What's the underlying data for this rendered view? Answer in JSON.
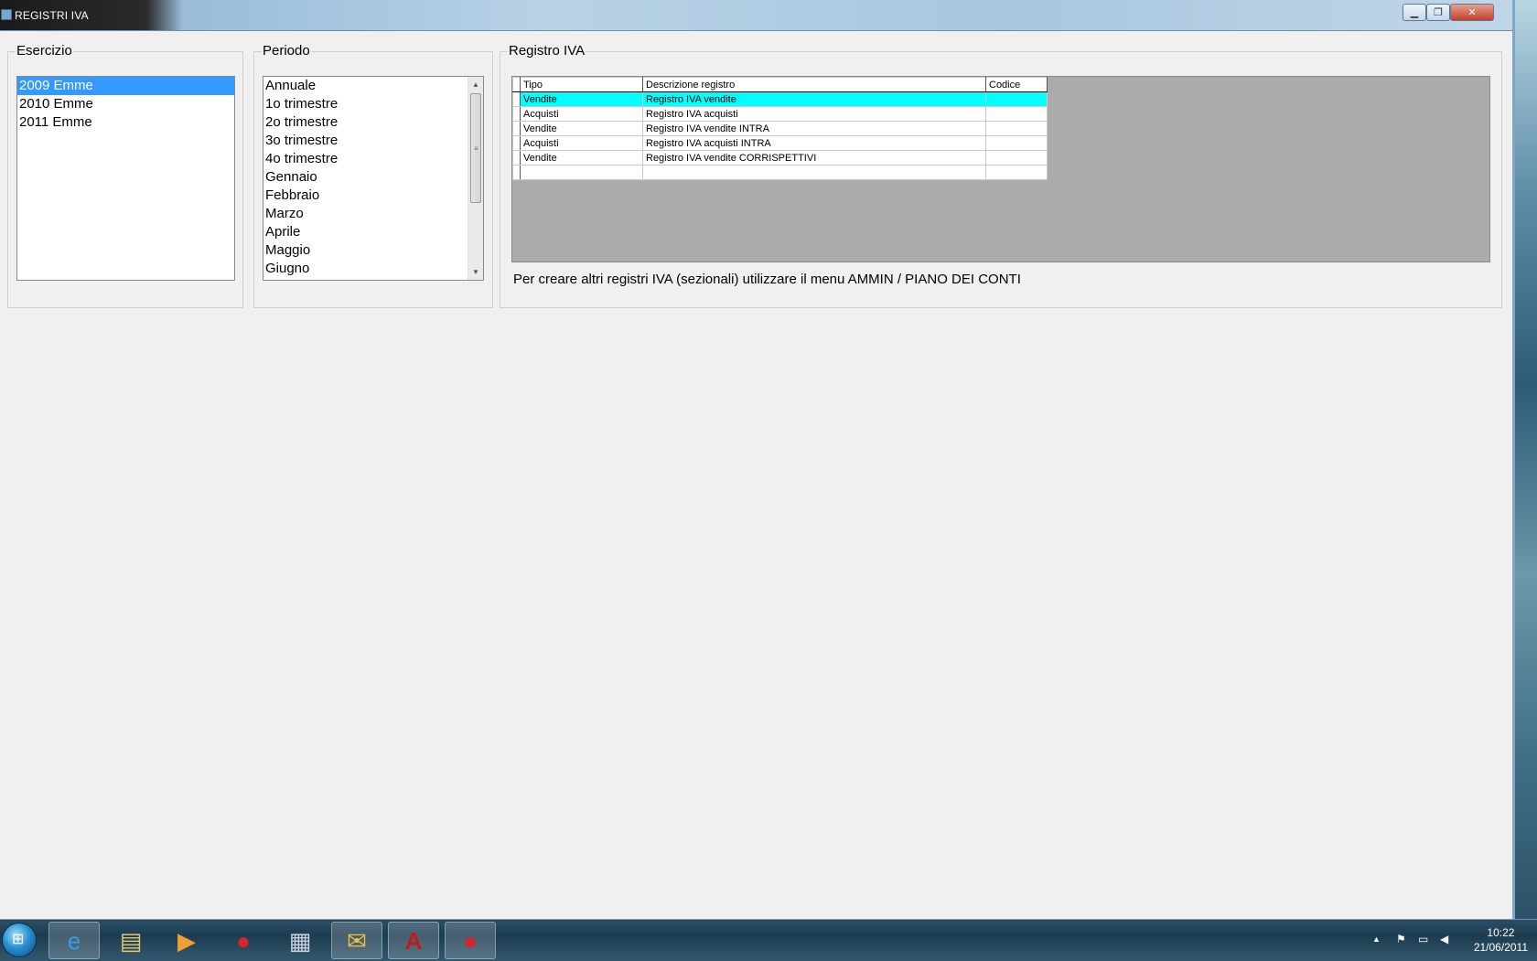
{
  "window": {
    "title": "REGISTRI IVA",
    "controls": {
      "minimize": "▁",
      "maximize": "❐",
      "close": "✕"
    }
  },
  "esercizio": {
    "label": "Esercizio",
    "items": [
      "2009 Emme",
      "2010 Emme",
      "2011 Emme"
    ],
    "selected_index": 0
  },
  "periodo": {
    "label": "Periodo",
    "items": [
      "Annuale",
      "1o trimestre",
      "2o trimestre",
      "3o trimestre",
      "4o trimestre",
      "Gennaio",
      "Febbraio",
      "Marzo",
      "Aprile",
      "Maggio",
      "Giugno"
    ],
    "scroll_up": "▲",
    "scroll_down": "▼",
    "scroll_grip": "≡"
  },
  "registro": {
    "label": "Registro IVA",
    "columns": [
      "Tipo",
      "Descrizione registro",
      "Codice"
    ],
    "rows": [
      {
        "tipo": "Vendite",
        "descrizione": "Registro IVA vendite",
        "codice": ""
      },
      {
        "tipo": "Acquisti",
        "descrizione": "Registro IVA acquisti",
        "codice": ""
      },
      {
        "tipo": "Vendite",
        "descrizione": "Registro IVA vendite INTRA",
        "codice": ""
      },
      {
        "tipo": "Acquisti",
        "descrizione": "Registro IVA acquisti INTRA",
        "codice": ""
      },
      {
        "tipo": "Vendite",
        "descrizione": "Registro IVA vendite CORRISPETTIVI",
        "codice": ""
      }
    ],
    "selected_row": 0,
    "hint": "Per creare altri registri IVA (sezionali) utilizzare il menu AMMIN / PIANO DEI CONTI"
  },
  "taskbar": {
    "start_icon": "windows-start-icon",
    "apps": [
      {
        "icon": "internet-explorer-icon",
        "glyph": "e",
        "color": "#3a9be6"
      },
      {
        "icon": "file-explorer-icon",
        "glyph": "▤",
        "color": "#e8c46a"
      },
      {
        "icon": "media-player-icon",
        "glyph": "▶",
        "color": "#f0a030"
      },
      {
        "icon": "strawberry-app-icon",
        "glyph": "●",
        "color": "#d8232a"
      },
      {
        "icon": "calculator-icon",
        "glyph": "▦",
        "color": "#c9d3dd"
      },
      {
        "icon": "outlook-icon",
        "glyph": "✉",
        "color": "#f2c23a"
      },
      {
        "icon": "acrobat-icon",
        "glyph": "A",
        "color": "#c21b17"
      },
      {
        "icon": "strawberry-app-icon",
        "glyph": "●",
        "color": "#d8232a"
      }
    ],
    "tray": {
      "show_hidden": "▲",
      "flag": "⚑",
      "network": "▭",
      "volume": "◀"
    },
    "clock_time": "10:22",
    "clock_date": "21/06/2011"
  }
}
